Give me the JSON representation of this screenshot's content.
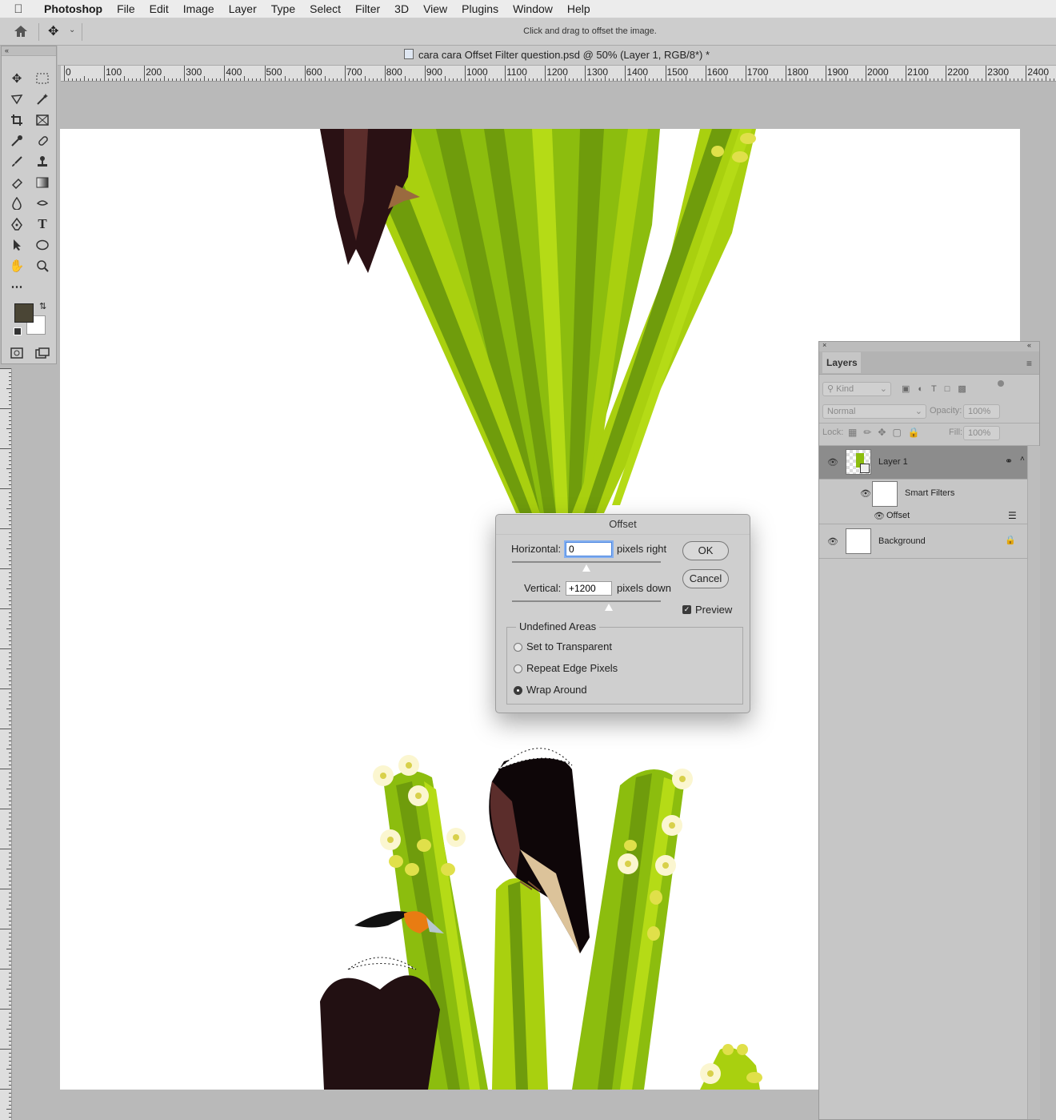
{
  "menubar": {
    "app": "Photoshop",
    "items": [
      "File",
      "Edit",
      "Image",
      "Layer",
      "Type",
      "Select",
      "Filter",
      "3D",
      "View",
      "Plugins",
      "Window",
      "Help"
    ]
  },
  "options_bar": {
    "hint": "Click and drag to offset the image."
  },
  "document": {
    "tab_title": "cara cara Offset Filter question.psd @ 50% (Layer 1, RGB/8*) *"
  },
  "ruler": {
    "labels": [
      "0",
      "100",
      "200",
      "300",
      "400",
      "500",
      "600",
      "700",
      "800",
      "900",
      "1000",
      "1100",
      "1200",
      "1300",
      "1400",
      "1500",
      "1600",
      "1700",
      "1800",
      "1900",
      "2000",
      "2100",
      "2200",
      "2300",
      "2400"
    ]
  },
  "layers_panel": {
    "tab": "Layers",
    "filter_placeholder": "Kind",
    "blend_mode": "Normal",
    "opacity_label": "Opacity:",
    "opacity_value": "100%",
    "lock_label": "Lock:",
    "fill_label": "Fill:",
    "fill_value": "100%",
    "layers": [
      {
        "name": "Layer 1"
      },
      {
        "name": "Smart Filters"
      },
      {
        "name": "Offset"
      },
      {
        "name": "Background"
      }
    ]
  },
  "offset_dialog": {
    "title": "Offset",
    "horizontal_label": "Horizontal:",
    "horizontal_value": "0",
    "horizontal_unit": "pixels right",
    "vertical_label": "Vertical:",
    "vertical_value": "+1200",
    "vertical_unit": "pixels down",
    "ok": "OK",
    "cancel": "Cancel",
    "preview_label": "Preview",
    "preview_checked": true,
    "undefined_areas_label": "Undefined Areas",
    "options": [
      "Set to Transparent",
      "Repeat Edge Pixels",
      "Wrap Around"
    ],
    "selected_option": "Wrap Around"
  },
  "colors": {
    "foreground": "#4a4535",
    "background": "#ffffff",
    "cactus_dark": "#6f9c0c",
    "cactus_light": "#a9d00f",
    "flower_yellow": "#e0e04a"
  }
}
